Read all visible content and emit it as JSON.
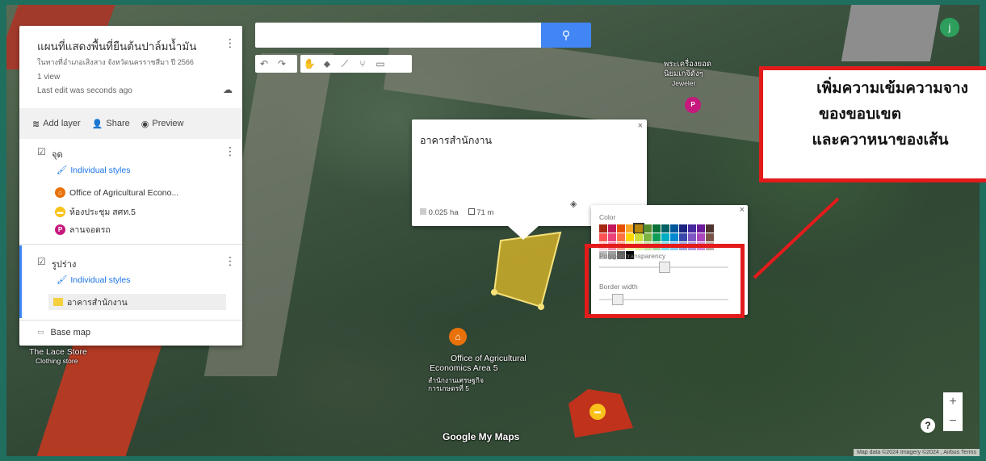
{
  "map_title": "แผนที่แสดงพื้นที่ยืนต้นปาล์มน้ำมัน",
  "map_subtitle": "ในทางที่อำเภอเสิงสาง จังหวัดนครราชสีมา ปี 2566",
  "views": "1 view",
  "last_edit": "Last edit was seconds ago",
  "toolbar": {
    "add_layer": "Add layer",
    "share": "Share",
    "preview": "Preview"
  },
  "layers": [
    {
      "name": "จุด",
      "styles": "Individual styles",
      "features": [
        {
          "label": "Office of Agricultural Econo...",
          "color": "#e8710a",
          "glyph": "⌂"
        },
        {
          "label": "ห้องประชุม สศท.5",
          "color": "#f9c21a",
          "glyph": "▬"
        },
        {
          "label": "ลานจอดรถ",
          "color": "#c5197d",
          "glyph": "P"
        }
      ]
    },
    {
      "name": "รูปร่าง",
      "styles": "Individual styles",
      "features": [
        {
          "label": "อาคารสำนักงาน",
          "color": "#f4d03f"
        }
      ]
    }
  ],
  "base_map": "Base map",
  "search": {
    "button_icon": "🔍",
    "placeholder": ""
  },
  "popup": {
    "title": "อาคารสำนักงาน",
    "area": "0.025 ha",
    "perimeter": "71 m",
    "close": "×"
  },
  "color_picker": {
    "color_label": "Color",
    "transparency_label": "Polygon transparency",
    "border_label": "Border width",
    "close": "×"
  },
  "callout_lines": [
    "เพิ่มความเข้มความจาง",
    "ของขอบเขต",
    "และควาหนาของเส้น"
  ],
  "map_labels": {
    "lace_store": "The Lace Store",
    "clothing": "Clothing store",
    "office": "Office of Agricultural",
    "office2": "Economics Area 5",
    "office_thai": "สำนักงานเศรษฐกิจ",
    "office_thai2": "การเกษตรที่ 5",
    "temple": "พระเครื่องยอด",
    "temple2": "นิยมเกจิดังๆ",
    "jeweler": "Jeweler"
  },
  "logo": "Google My Maps",
  "attribution": "Map data ©2024 Imagery ©2024 , Airbus   Terms",
  "avatar_letter": "j",
  "zoom": {
    "plus": "+",
    "minus": "−",
    "help": "?"
  },
  "swatch_colors": [
    "#a52714",
    "#c2185b",
    "#e65100",
    "#f9a825",
    "#b8860b",
    "#558b2f",
    "#097138",
    "#006064",
    "#01579b",
    "#1a237e",
    "#4527a0",
    "#6a1b9a",
    "#4e342e",
    "#ff5252",
    "#ec407a",
    "#ff7043",
    "#ffd600",
    "#cddc39",
    "#7cb342",
    "#0f9d58",
    "#00acc1",
    "#0288d1",
    "#3949ab",
    "#7e57c2",
    "#ab47bc",
    "#795548",
    "#ffcdd2",
    "#f48fb1",
    "#ffab91",
    "#fff59d",
    "#e6ee9c",
    "#c5e1a5",
    "#a5d6a7",
    "#80deea",
    "#90caf9",
    "#9fa8da",
    "#b39ddb",
    "#ce93d8",
    "#bcaaa4",
    "#bdbdbd",
    "#9e9e9e",
    "#616161",
    "#000000"
  ]
}
